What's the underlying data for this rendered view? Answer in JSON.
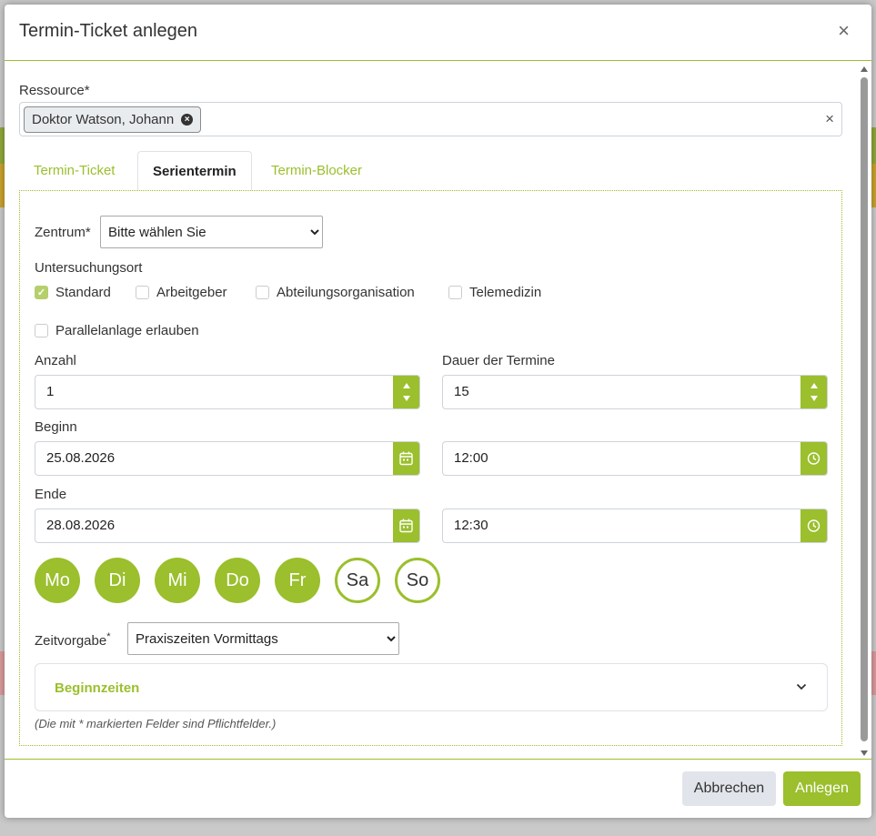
{
  "dialog": {
    "title": "Termin-Ticket anlegen",
    "close_glyph": "×"
  },
  "resource": {
    "label": "Ressource*",
    "chip": "Doktor Watson, Johann",
    "clear_glyph": "×"
  },
  "tabs": [
    {
      "label": "Termin-Ticket",
      "active": false
    },
    {
      "label": "Serientermin",
      "active": true
    },
    {
      "label": "Termin-Blocker",
      "active": false
    }
  ],
  "zentrum": {
    "label": "Zentrum*",
    "value": "Bitte wählen Sie"
  },
  "untersuchungsort": {
    "label": "Untersuchungsort",
    "options": [
      {
        "label": "Standard",
        "checked": true
      },
      {
        "label": "Arbeitgeber",
        "checked": false
      },
      {
        "label": "Abteilungsorganisation",
        "checked": false
      },
      {
        "label": "Telemedizin",
        "checked": false
      }
    ]
  },
  "parallel": {
    "label": "Parallelanlage erlauben",
    "checked": false
  },
  "anzahl": {
    "label": "Anzahl",
    "value": "1"
  },
  "dauer": {
    "label": "Dauer der Termine",
    "value": "15"
  },
  "beginn": {
    "label": "Beginn",
    "date": "25.08.2026",
    "time": "12:00"
  },
  "ende": {
    "label": "Ende",
    "date": "28.08.2026",
    "time": "12:30"
  },
  "weekdays": [
    {
      "label": "Mo",
      "selected": true
    },
    {
      "label": "Di",
      "selected": true
    },
    {
      "label": "Mi",
      "selected": true
    },
    {
      "label": "Do",
      "selected": true
    },
    {
      "label": "Fr",
      "selected": true
    },
    {
      "label": "Sa",
      "selected": false
    },
    {
      "label": "So",
      "selected": false
    }
  ],
  "zeitvorgabe": {
    "label": "Zeitvorgabe",
    "required_mark": "*",
    "value": "Praxiszeiten Vormittags"
  },
  "beginnzeiten": {
    "label": "Beginnzeiten"
  },
  "footnote": "(Die mit * markierten Felder sind Pflichtfelder.)",
  "buttons": {
    "cancel": "Abbrechen",
    "create": "Anlegen"
  },
  "colors": {
    "accent": "#9bbf2d",
    "cancel_bg": "#e1e4ea"
  }
}
